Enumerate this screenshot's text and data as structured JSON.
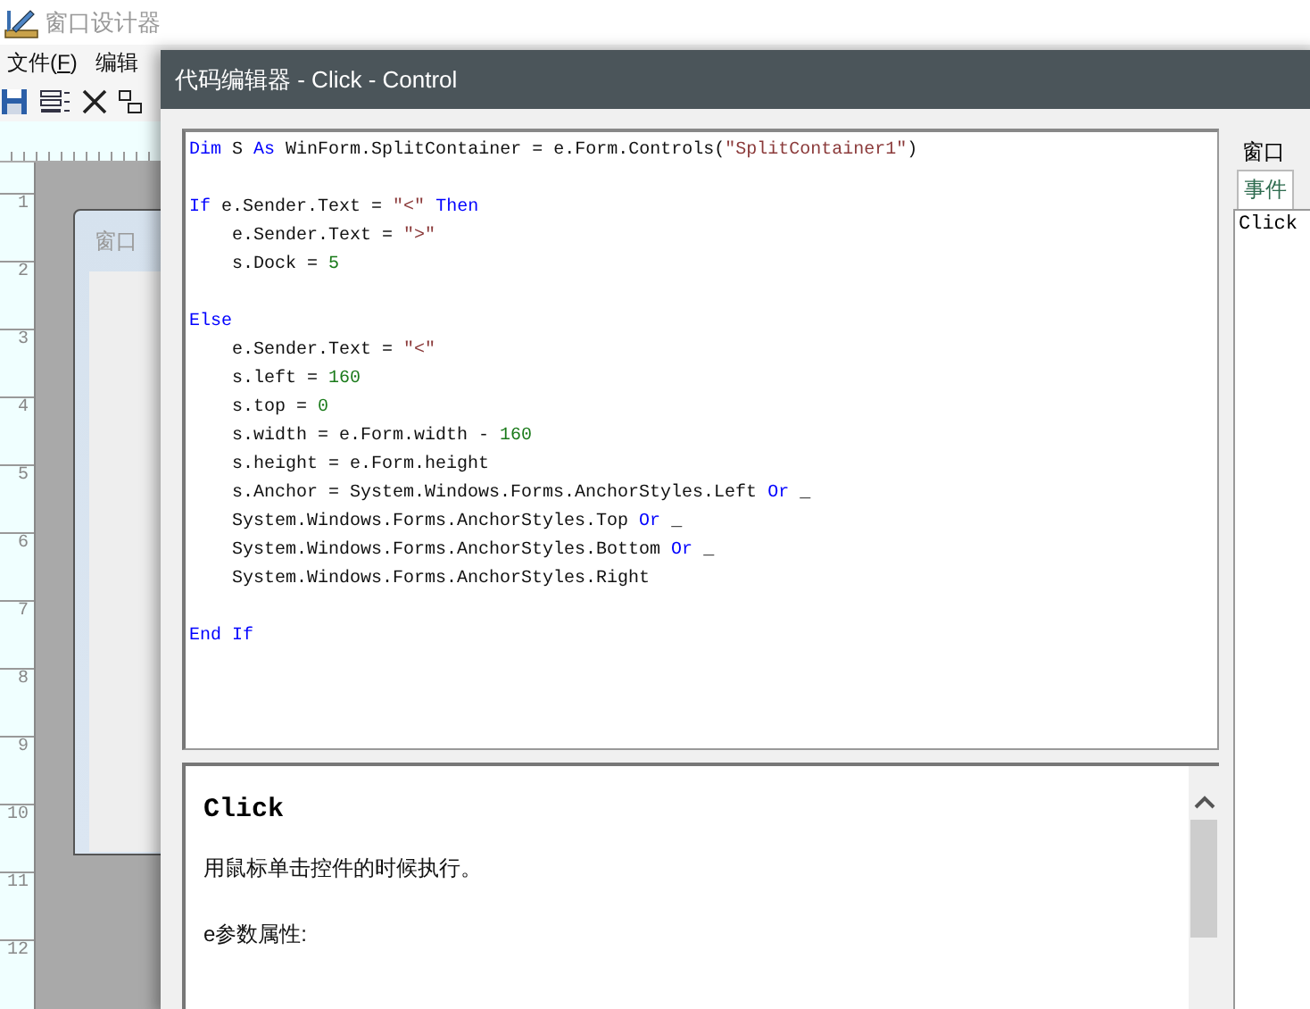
{
  "app": {
    "title": "窗口设计器",
    "menu": [
      {
        "before": "文件(",
        "key": "F",
        "after": ")"
      },
      {
        "before": "编辑"
      }
    ]
  },
  "ruler": [
    "1",
    "2",
    "3",
    "4",
    "5",
    "6",
    "7",
    "8",
    "9",
    "10",
    "11",
    "12"
  ],
  "form_preview": {
    "title": "窗口"
  },
  "dialog": {
    "title": "代码编辑器 - Click - Control",
    "code_blocks": [
      [
        {
          "indent": false,
          "segs": [
            {
              "t": "Dim",
              "kind": "kw"
            },
            {
              "t": " S ",
              "kind": "plain"
            },
            {
              "t": "As",
              "kind": "kw"
            },
            {
              "t": " WinForm.SplitContainer = e.Form.Controls(",
              "kind": "plain"
            },
            {
              "t": "\"SplitContainer1\"",
              "kind": "str"
            },
            {
              "t": ")",
              "kind": "plain"
            }
          ]
        }
      ],
      [
        {
          "indent": false,
          "segs": [
            {
              "t": "If",
              "kind": "kw"
            },
            {
              "t": " e.Sender.Text = ",
              "kind": "plain"
            },
            {
              "t": "\"<\"",
              "kind": "str"
            },
            {
              "t": " Then",
              "kind": "kw"
            }
          ]
        },
        {
          "indent": true,
          "segs": [
            {
              "t": "e.Sender.Text = ",
              "kind": "plain"
            },
            {
              "t": "\">\"",
              "kind": "str"
            }
          ]
        },
        {
          "indent": true,
          "segs": [
            {
              "t": "s.Dock = ",
              "kind": "plain"
            },
            {
              "t": "5",
              "kind": "num"
            }
          ]
        }
      ],
      [
        {
          "indent": false,
          "segs": [
            {
              "t": "Else",
              "kind": "kw"
            }
          ]
        },
        {
          "indent": true,
          "segs": [
            {
              "t": "e.Sender.Text = ",
              "kind": "plain"
            },
            {
              "t": "\"<\"",
              "kind": "str"
            }
          ]
        },
        {
          "indent": true,
          "segs": [
            {
              "t": "s.left = ",
              "kind": "plain"
            },
            {
              "t": "160",
              "kind": "num"
            }
          ]
        },
        {
          "indent": true,
          "segs": [
            {
              "t": "s.top = ",
              "kind": "plain"
            },
            {
              "t": "0",
              "kind": "num"
            }
          ]
        },
        {
          "indent": true,
          "segs": [
            {
              "t": "s.width = e.Form.width - ",
              "kind": "plain"
            },
            {
              "t": "160",
              "kind": "num"
            }
          ]
        },
        {
          "indent": true,
          "segs": [
            {
              "t": "s.height = e.Form.height",
              "kind": "plain"
            }
          ]
        },
        {
          "indent": true,
          "segs": [
            {
              "t": "s.Anchor = System.Windows.Forms.AnchorStyles.Left ",
              "kind": "plain"
            },
            {
              "t": "Or",
              "kind": "kw"
            },
            {
              "t": " _",
              "kind": "plain"
            }
          ]
        },
        {
          "indent": true,
          "segs": [
            {
              "t": "System.Windows.Forms.AnchorStyles.Top ",
              "kind": "plain"
            },
            {
              "t": "Or",
              "kind": "kw"
            },
            {
              "t": " _",
              "kind": "plain"
            }
          ]
        },
        {
          "indent": true,
          "segs": [
            {
              "t": "System.Windows.Forms.AnchorStyles.Bottom ",
              "kind": "plain"
            },
            {
              "t": "Or",
              "kind": "kw"
            },
            {
              "t": " _",
              "kind": "plain"
            }
          ]
        },
        {
          "indent": true,
          "segs": [
            {
              "t": "System.Windows.Forms.AnchorStyles.Right",
              "kind": "plain"
            }
          ]
        }
      ],
      [
        {
          "indent": false,
          "segs": [
            {
              "t": "End If",
              "kind": "kw"
            }
          ]
        }
      ]
    ],
    "help": {
      "heading": "Click",
      "lines": [
        "用鼠标单击控件的时候执行。",
        "e参数属性:"
      ]
    },
    "side_panel": {
      "label": "窗口",
      "tabs": [
        {
          "label": "事件",
          "selected": true
        }
      ],
      "events": [
        {
          "label": "Click"
        }
      ]
    }
  }
}
